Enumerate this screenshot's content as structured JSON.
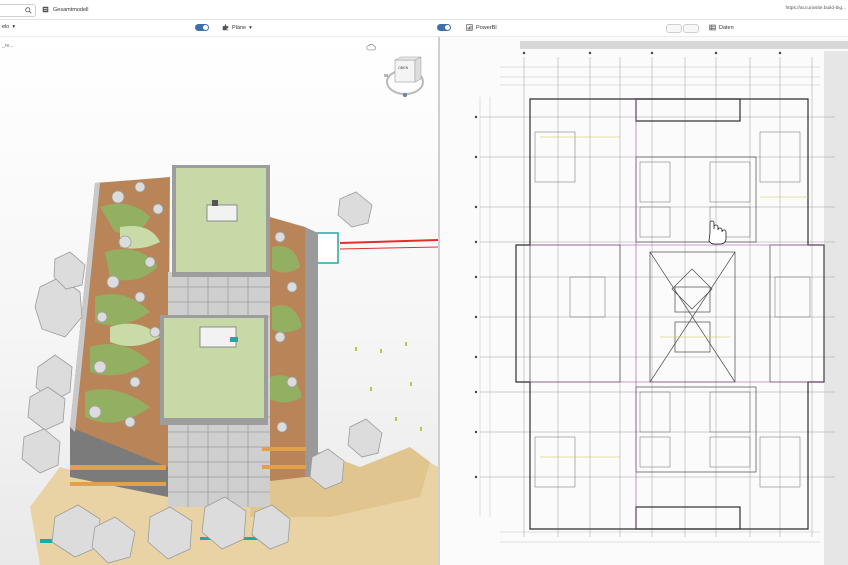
{
  "header": {
    "model_title": "Gesamtmodell",
    "url": "https://accurixsite.build-big..."
  },
  "toolbar": {
    "view_label": "elo",
    "plans_label": "Pläne",
    "powerbi_label": "PowerBI",
    "data_label": "Daten"
  },
  "viewer": {
    "breadcrumb": "_re...",
    "compass_label": "OBEN",
    "compass_west": "W"
  },
  "colors": {
    "accent": "#3f6fa8",
    "roof_green": "#c7d9a7",
    "terrace_brown": "#b98558",
    "rail_red": "#e0302a"
  }
}
